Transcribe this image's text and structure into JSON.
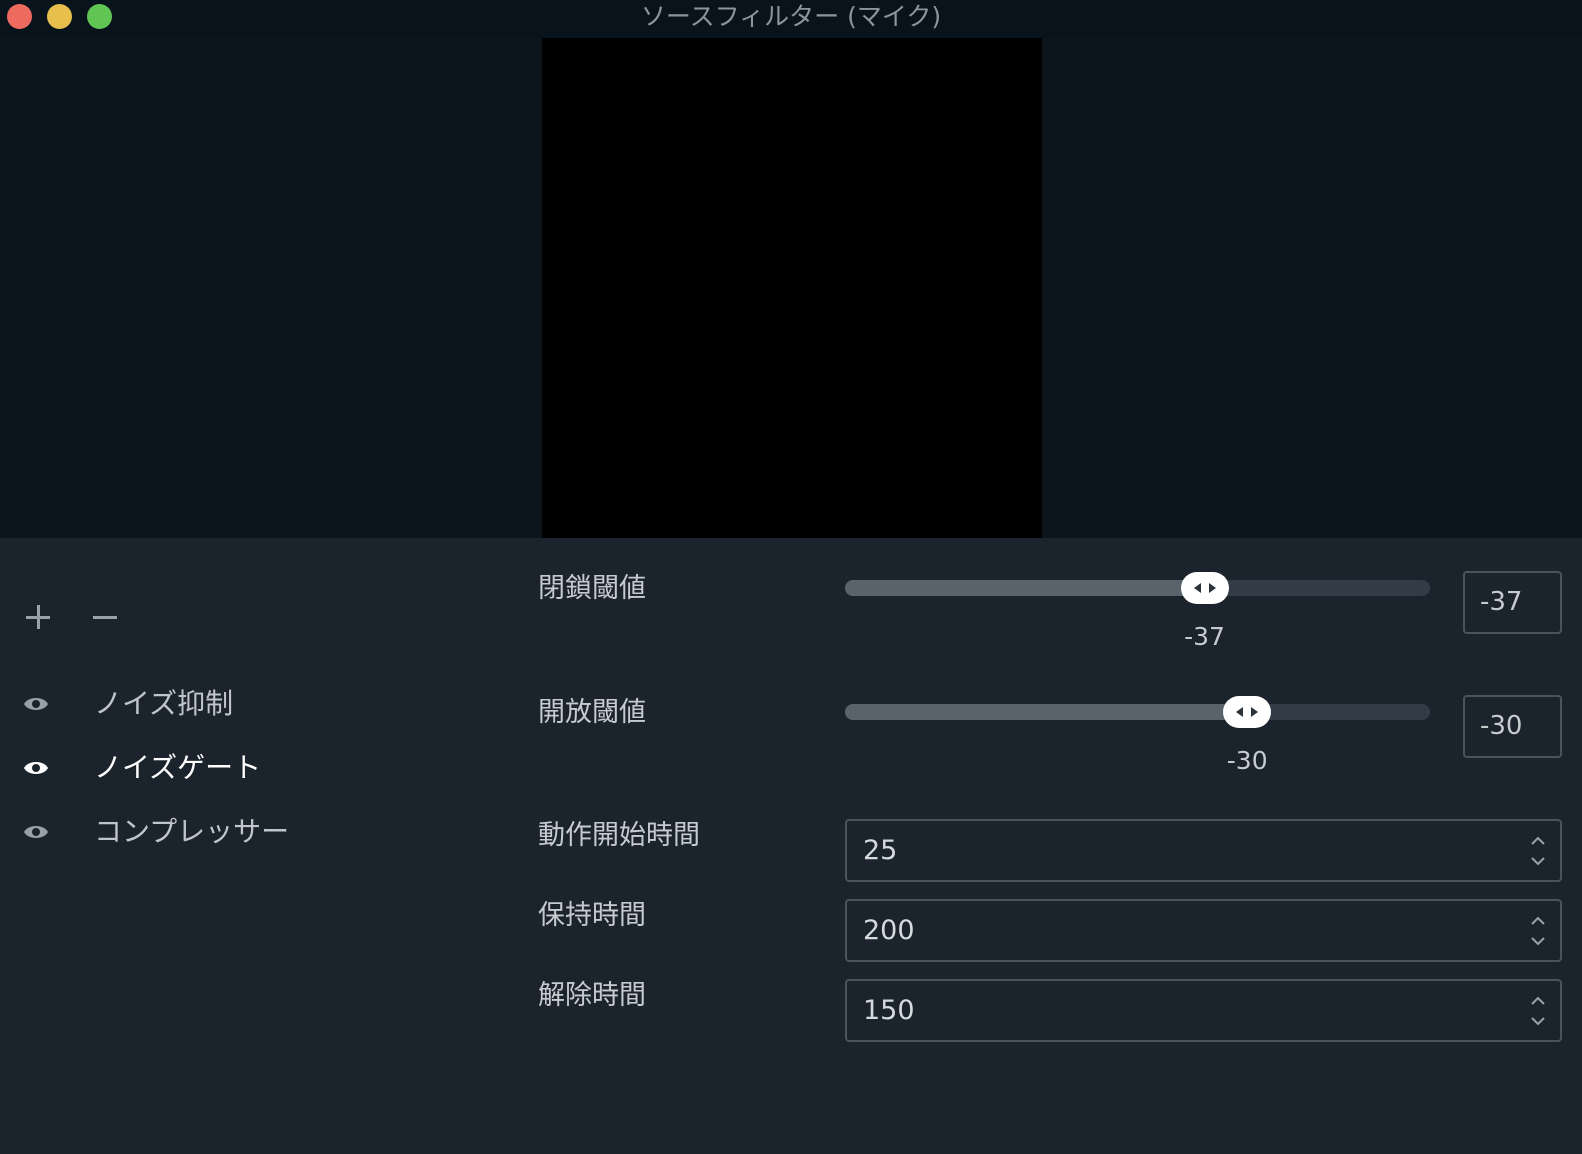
{
  "window": {
    "title": "ソースフィルター (マイク)",
    "traffic_colors": {
      "close": "#ed6a5e",
      "minimize": "#e6bf4c",
      "maximize": "#61c554"
    }
  },
  "preview": {
    "background": "#000000"
  },
  "filters": [
    {
      "label": "ノイズ抑制",
      "visible_icon": "eye-icon",
      "active": false
    },
    {
      "label": "ノイズゲート",
      "visible_icon": "eye-icon",
      "active": true
    },
    {
      "label": "コンプレッサー",
      "visible_icon": "eye-icon",
      "active": false
    }
  ],
  "toolbar": {
    "add_icon": "plus-icon",
    "remove_icon": "minus-icon"
  },
  "settings": {
    "close_threshold": {
      "label": "閉鎖閾値",
      "value": "-37",
      "min": -96,
      "max": 0
    },
    "open_threshold": {
      "label": "開放閾値",
      "value": "-30",
      "min": -96,
      "max": 0
    },
    "attack_time": {
      "label": "動作開始時間",
      "value": "25"
    },
    "hold_time": {
      "label": "保持時間",
      "value": "200"
    },
    "release_time": {
      "label": "解除時間",
      "value": "150"
    }
  }
}
